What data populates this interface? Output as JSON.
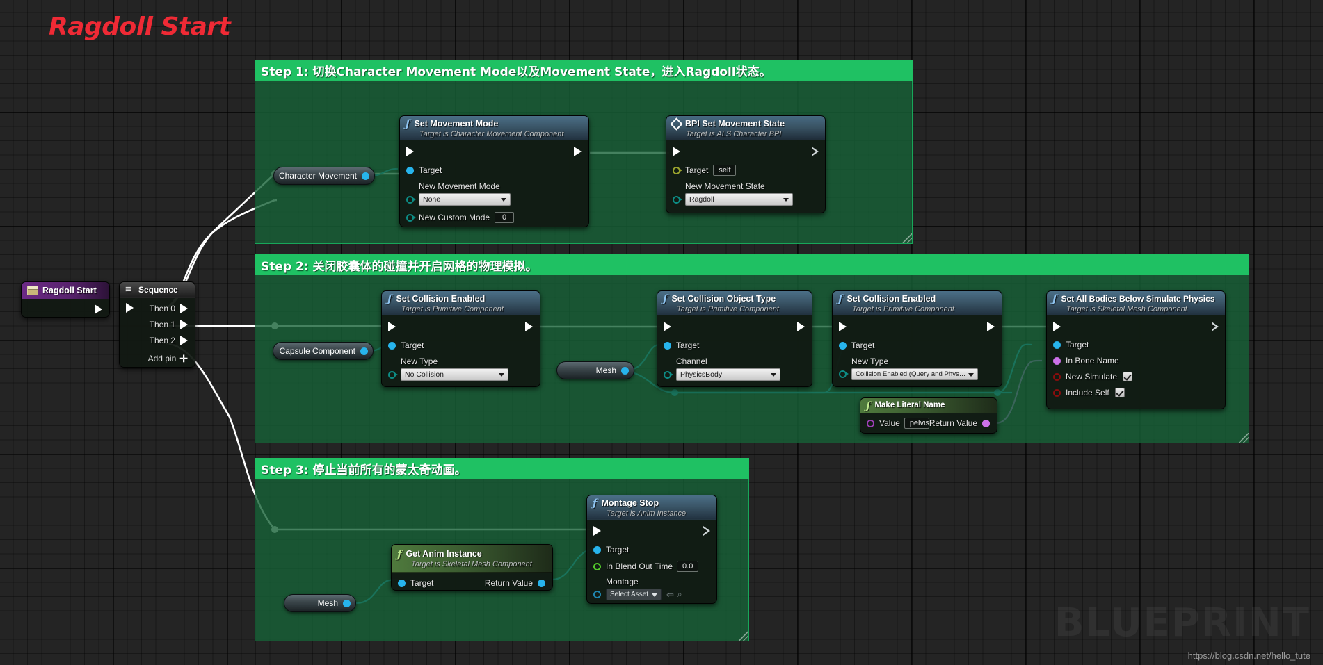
{
  "graph": {
    "title": "Ragdoll Start",
    "watermark": "BLUEPRINT",
    "url": "https://blog.csdn.net/hello_tute"
  },
  "comments": [
    {
      "id": "step1",
      "title": "Step 1: 切换Character Movement Mode以及Movement State，进入Ragdoll状态。"
    },
    {
      "id": "step2",
      "title": "Step 2: 关闭胶囊体的碰撞并开启网格的物理模拟。"
    },
    {
      "id": "step3",
      "title": "Step 3: 停止当前所有的蒙太奇动画。"
    }
  ],
  "nodes": {
    "ragdoll_start": {
      "title": "Ragdoll Start"
    },
    "sequence": {
      "title": "Sequence",
      "then0": "Then 0",
      "then1": "Then 1",
      "then2": "Then 2",
      "add_pin": "Add pin"
    },
    "set_movement_mode": {
      "title": "Set Movement Mode",
      "subtitle": "Target is Character Movement Component",
      "target": "Target",
      "new_movement_mode_label": "New Movement Mode",
      "new_movement_mode_value": "None",
      "new_custom_mode_label": "New Custom Mode",
      "new_custom_mode_value": "0"
    },
    "bpi_set_movement_state": {
      "title": "BPI Set Movement State",
      "subtitle": "Target is ALS Character BPI",
      "target": "Target",
      "target_value": "self",
      "new_movement_state_label": "New Movement State",
      "new_movement_state_value": "Ragdoll"
    },
    "set_collision_enabled_capsule": {
      "title": "Set Collision Enabled",
      "subtitle": "Target is Primitive Component",
      "target": "Target",
      "new_type_label": "New Type",
      "new_type_value": "No Collision"
    },
    "set_collision_object_type": {
      "title": "Set Collision Object Type",
      "subtitle": "Target is Primitive Component",
      "target": "Target",
      "channel_label": "Channel",
      "channel_value": "PhysicsBody"
    },
    "set_collision_enabled_mesh": {
      "title": "Set Collision Enabled",
      "subtitle": "Target is Primitive Component",
      "target": "Target",
      "new_type_label": "New Type",
      "new_type_value": "Collision Enabled (Query and Physics)"
    },
    "set_all_bodies_below_simulate_physics": {
      "title": "Set All Bodies Below Simulate Physics",
      "subtitle": "Target is Skeletal Mesh Component",
      "target": "Target",
      "in_bone_name": "In Bone Name",
      "new_simulate": "New Simulate",
      "include_self": "Include Self"
    },
    "make_literal_name": {
      "title": "Make Literal Name",
      "value_label": "Value",
      "value": "pelvis",
      "return_value": "Return Value"
    },
    "montage_stop": {
      "title": "Montage Stop",
      "subtitle": "Target is Anim Instance",
      "target": "Target",
      "in_blend_out_time_label": "In Blend Out Time",
      "in_blend_out_time_value": "0.0",
      "montage_label": "Montage",
      "montage_value": "Select Asset"
    },
    "get_anim_instance": {
      "title": "Get Anim Instance",
      "subtitle": "Target is Skeletal Mesh Component",
      "target": "Target",
      "return_value": "Return Value"
    },
    "var_character_movement": {
      "title": "Character Movement"
    },
    "var_capsule_component": {
      "title": "Capsule Component"
    },
    "var_mesh_step2": {
      "title": "Mesh"
    },
    "var_mesh_step3": {
      "title": "Mesh"
    }
  },
  "colors": {
    "comment_header": "#1fc163",
    "comment_body": "#166237",
    "exec_wire": "#ffffff",
    "object_wire": "#27b4ec",
    "name_wire": "#cc71e8",
    "title_red": "#ef2a35"
  }
}
